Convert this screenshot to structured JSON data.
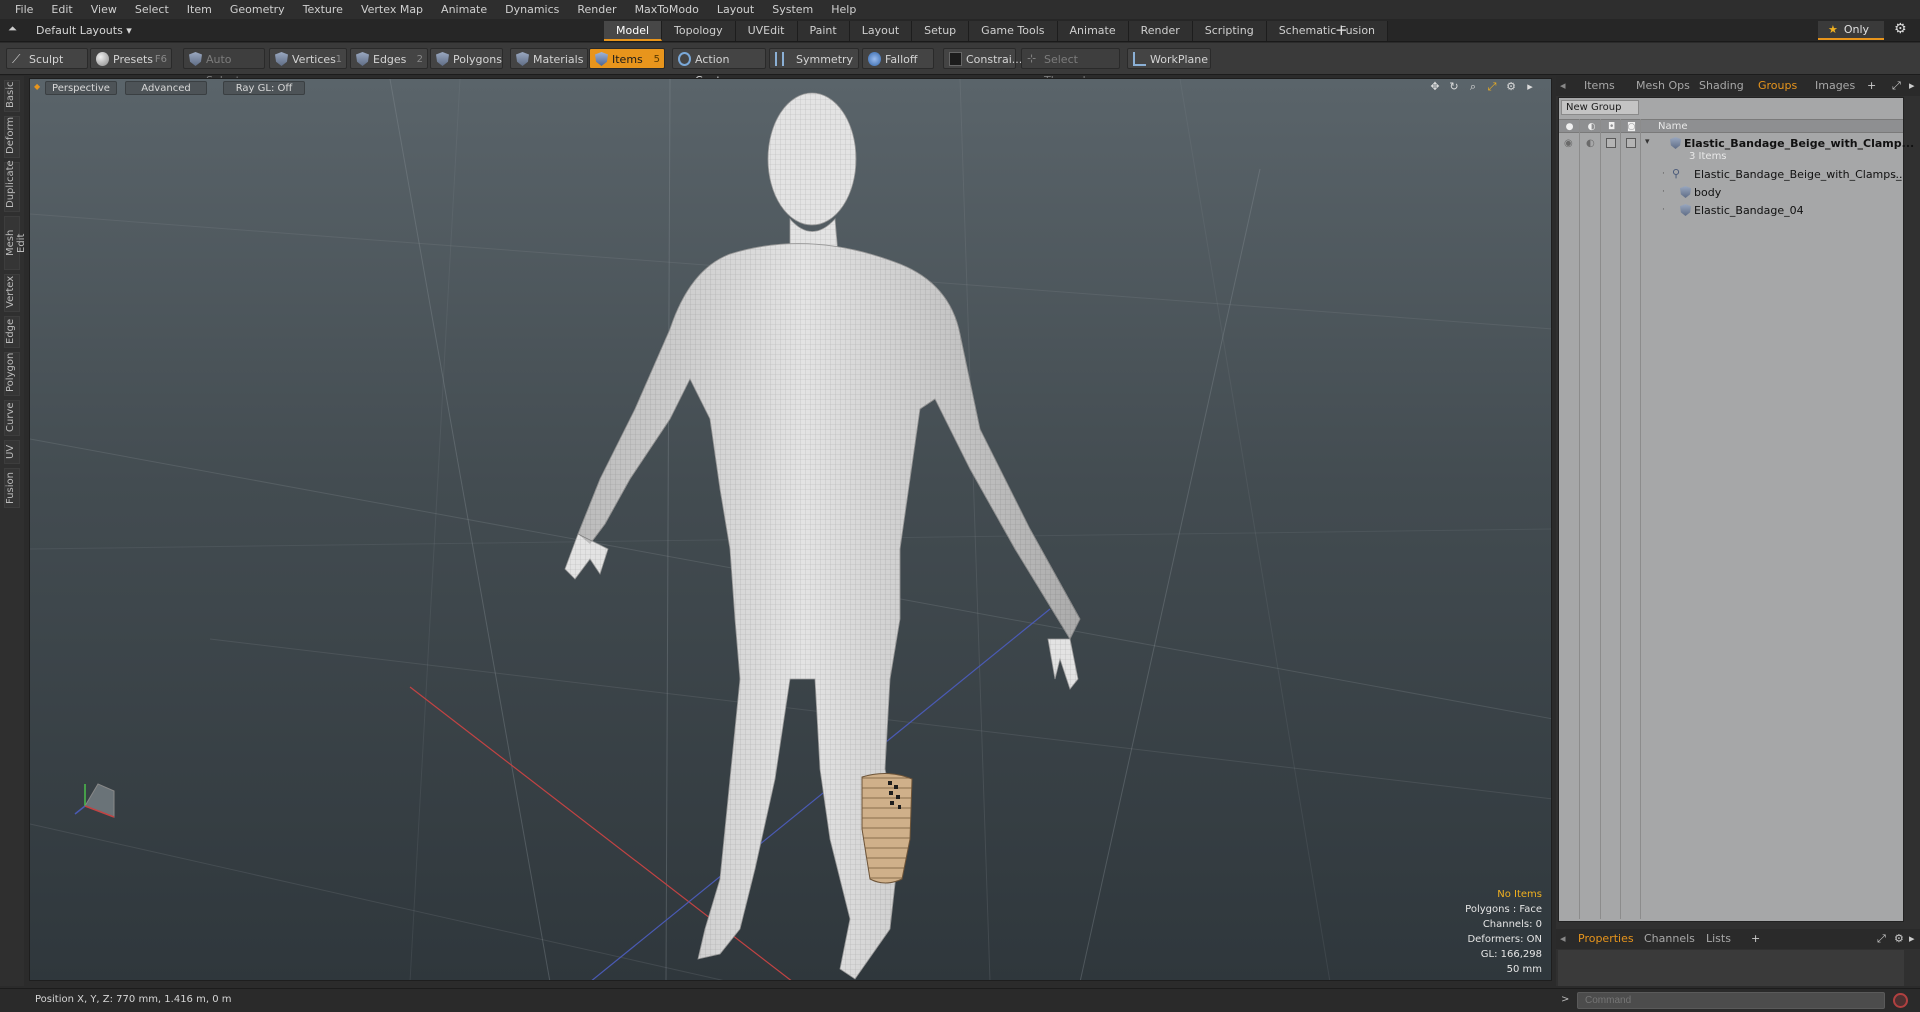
{
  "menu": [
    "File",
    "Edit",
    "View",
    "Select",
    "Item",
    "Geometry",
    "Texture",
    "Vertex Map",
    "Animate",
    "Dynamics",
    "Render",
    "MaxToModo",
    "Layout",
    "System",
    "Help"
  ],
  "layout": {
    "dropdown": "Default Layouts ▾",
    "tabs": [
      "Model",
      "Topology",
      "UVEdit",
      "Paint",
      "Layout",
      "Setup",
      "Game Tools",
      "Animate",
      "Render",
      "Scripting",
      "Schematic Fusion"
    ],
    "active_tab": "Model",
    "only_label": "Only"
  },
  "toolbar": {
    "sculpt": "Sculpt",
    "presets": "Presets",
    "presets_key": "F6",
    "auto_select": "Auto Select",
    "vertices": "Vertices",
    "vertices_n": "1",
    "edges": "Edges",
    "edges_n": "2",
    "polygons": "Polygons",
    "materials": "Materials",
    "items": "Items",
    "items_n": "5",
    "action_center": "Action Center",
    "symmetry": "Symmetry",
    "falloff": "Falloff",
    "constraints": "Constrai...",
    "select_through": "Select Through",
    "workplane": "WorkPlane"
  },
  "left_tabs": [
    "Basic",
    "Deform",
    "Duplicate",
    "Mesh Edit",
    "Vertex",
    "Edge",
    "Polygon",
    "Curve",
    "UV",
    "Fusion"
  ],
  "viewport": {
    "perspective": "Perspective",
    "advanced": "Advanced",
    "raygl": "Ray GL: Off",
    "status": {
      "no_items": "No Items",
      "polygons": "Polygons : Face",
      "channels": "Channels: 0",
      "deformers": "Deformers: ON",
      "gl": "GL: 166,298",
      "scale": "50 mm"
    }
  },
  "right_tabs": [
    "Items",
    "Mesh Ops",
    "Shading",
    "Groups",
    "Images"
  ],
  "right_active": "Groups",
  "groups": {
    "new_group": "New Group",
    "col_name": "Name",
    "root": {
      "label": "Elastic_Bandage_Beige_with_Clamp...",
      "count": "3 Items"
    },
    "children": [
      "Elastic_Bandage_Beige_with_Clamps_",
      "body",
      "Elastic_Bandage_04"
    ],
    "child_more": "..."
  },
  "bottom_tabs": [
    "Properties",
    "Channels",
    "Lists"
  ],
  "bottom_active": "Properties",
  "statusbar": {
    "position": "Position X, Y, Z:   770 mm, 1.416 m, 0 m",
    "command_placeholder": "Command"
  },
  "colors": {
    "accent": "#e8951c",
    "viewport_top": "#5a646a",
    "viewport_bottom": "#2f373c",
    "panel": "#a6a7a8"
  }
}
